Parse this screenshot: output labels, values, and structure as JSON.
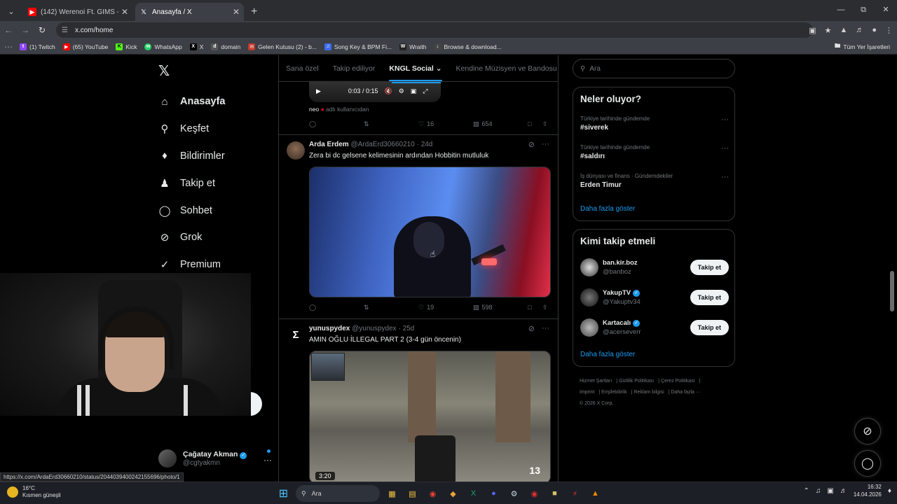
{
  "browser": {
    "tabs": [
      {
        "title": "(142) Werenoi Ft. GIMS - Pianó",
        "favicon": "youtube-icon",
        "active": false
      },
      {
        "title": "Anasayfa / X",
        "favicon": "x-icon",
        "active": true
      }
    ],
    "url": "x.com/home",
    "bookmarks": [
      {
        "label": "(1) Twitch",
        "icon": "twitch-icon",
        "color": "#9146ff"
      },
      {
        "label": "(65) YouTube",
        "icon": "youtube-icon",
        "color": "#ff0000"
      },
      {
        "label": "Kick",
        "icon": "kick-icon",
        "color": "#53fc18"
      },
      {
        "label": "WhatsApp",
        "icon": "whatsapp-icon",
        "color": "#25d366"
      },
      {
        "label": "X",
        "icon": "x-icon",
        "color": "#000000"
      },
      {
        "label": "domain",
        "icon": "domain-icon",
        "color": "#555555"
      },
      {
        "label": "Gelen Kutusu (2) - b...",
        "icon": "mail-icon",
        "color": "#c23a2b"
      },
      {
        "label": "Song Key & BPM Fi...",
        "icon": "music-icon",
        "color": "#3b6df0"
      },
      {
        "label": "Wraith",
        "icon": "wraith-icon",
        "color": "#222222"
      },
      {
        "label": "Browse & download...",
        "icon": "download-icon",
        "color": "#444444"
      }
    ],
    "all_bookmarks": "Tüm Yer İşaretleri"
  },
  "nav": {
    "items": [
      {
        "label": "Anasayfa",
        "icon": "home-icon",
        "active": true
      },
      {
        "label": "Keşfet",
        "icon": "search-icon",
        "active": false
      },
      {
        "label": "Bildirimler",
        "icon": "bell-icon",
        "active": false
      },
      {
        "label": "Takip et",
        "icon": "add-user-icon",
        "active": false
      },
      {
        "label": "Sohbet",
        "icon": "chat-icon",
        "active": false
      },
      {
        "label": "Grok",
        "icon": "grok-icon",
        "active": false
      },
      {
        "label": "Premium",
        "icon": "verified-badge-icon",
        "active": false
      }
    ],
    "profile": {
      "name": "Çağatay Akman",
      "handle": "@cgtyakmn"
    }
  },
  "status_link": "https://x.com/ArdaErd30660210/status/2044039400242155696/photo/1",
  "feed": {
    "tabs": [
      "Sana özel",
      "Takip ediliyor",
      "KNGL Social",
      "Kendine Müzisyen ve Bandosu"
    ],
    "active_tab": "KNGL Social",
    "partial_tweet": {
      "video_time": "0:03 / 0:15",
      "reply_user": "neo",
      "reply_suffix": "adlı kullanıcıdan",
      "likes": "16",
      "views": "654"
    },
    "tweets": [
      {
        "name": "Arda Erdem",
        "handle": "@ArdaErd30660210",
        "time": "24d",
        "text": "Zera bi dc gelsene kelimesinin ardından Hobbitin mutluluk",
        "likes": "19",
        "views": "598"
      },
      {
        "name": "yunuspydex",
        "handle": "@yunuspydex",
        "time": "25d",
        "text": "AMIN OĞLU İLLEGAL PART 2 (3-4 gün öncenin)",
        "video_duration": "3:20",
        "overlay_number": "13"
      }
    ]
  },
  "right": {
    "search_placeholder": "Ara",
    "trends_title": "Neler oluyor?",
    "trends": [
      {
        "category": "Türkiye tarihinde gündemde",
        "title": "#siverek"
      },
      {
        "category": "Türkiye tarihinde gündemde",
        "title": "#saldırı"
      },
      {
        "category": "İş dünyası ve finans · Gündemdekiler",
        "title": "Erden Timur"
      }
    ],
    "show_more": "Daha fazla göster",
    "wtf_title": "Kimi takip etmeli",
    "follow_label": "Takip et",
    "suggestions": [
      {
        "name": "ban.kir.boz",
        "handle": "@banboz",
        "verified": false
      },
      {
        "name": "YakupTV",
        "handle": "@Yakuptv34",
        "verified": true
      },
      {
        "name": "Kartacalı",
        "handle": "@acerseverr",
        "verified": true
      }
    ],
    "footer": [
      "Hizmet Şartları",
      "Gizlilik Politikası",
      "Çerez Politikası",
      "Imprint",
      "Erişilebilirlik",
      "Reklam bilgisi",
      "Daha fazla ···",
      "© 2026 X Corp."
    ]
  },
  "taskbar": {
    "temperature": "16°C",
    "weather": "Kısmen güneşli",
    "search": "Ara",
    "time": "16:32",
    "date": "14.04.2026"
  },
  "colors": {
    "accent": "#1d9bf0",
    "background": "#000000",
    "border": "#2f3336"
  }
}
